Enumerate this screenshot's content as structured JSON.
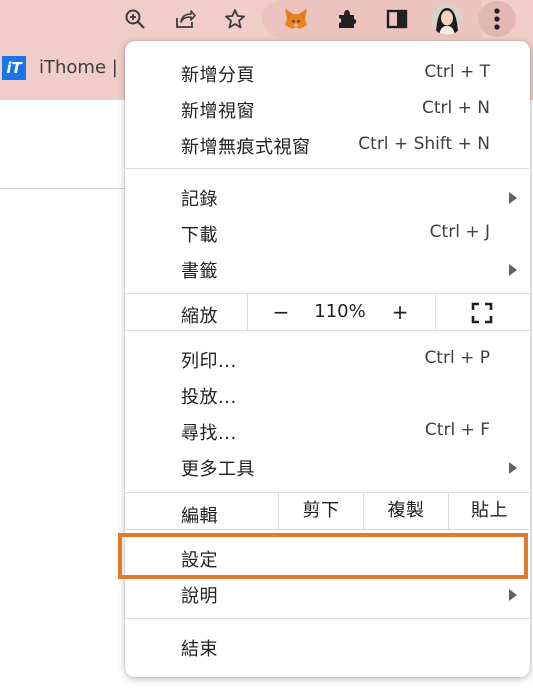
{
  "bookmarks": {
    "favicon_text": "iT",
    "label": "iThome | i"
  },
  "toolbar": {
    "icons": [
      "zoom-icon",
      "share-icon",
      "bookmark-star-icon",
      "metamask-fox-icon",
      "extensions-puzzle-icon",
      "side-panel-icon",
      "profile-avatar-icon",
      "more-menu-icon"
    ]
  },
  "menu": {
    "new_tab": {
      "label": "新增分頁",
      "shortcut": "Ctrl + T"
    },
    "new_window": {
      "label": "新增視窗",
      "shortcut": "Ctrl + N"
    },
    "incognito": {
      "label": "新增無痕式視窗",
      "shortcut": "Ctrl + Shift + N"
    },
    "history": {
      "label": "記錄"
    },
    "downloads": {
      "label": "下載",
      "shortcut": "Ctrl + J"
    },
    "bookmarks": {
      "label": "書籤"
    },
    "zoom": {
      "label": "縮放",
      "minus": "−",
      "value": "110%",
      "plus": "+"
    },
    "print": {
      "label": "列印...",
      "shortcut": "Ctrl + P"
    },
    "cast": {
      "label": "投放..."
    },
    "find": {
      "label": "尋找...",
      "shortcut": "Ctrl + F"
    },
    "more_tools": {
      "label": "更多工具"
    },
    "edit": {
      "label": "編輯",
      "cut": "剪下",
      "copy": "複製",
      "paste": "貼上"
    },
    "settings": {
      "label": "設定"
    },
    "help": {
      "label": "說明"
    },
    "exit": {
      "label": "結束"
    }
  },
  "colors": {
    "toolbar_bg": "#f1cdc9",
    "highlight": "#e07b2c",
    "separator": "#dadce0"
  }
}
